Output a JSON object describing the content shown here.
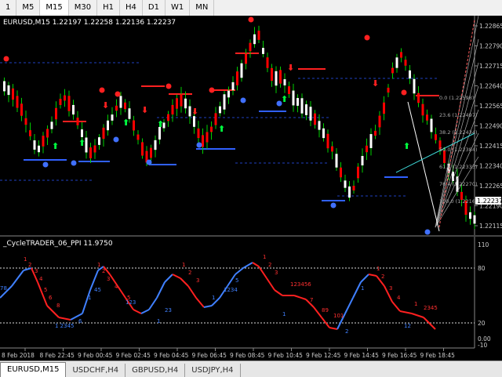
{
  "timeframes": [
    "1",
    "M5",
    "M15",
    "M30",
    "H1",
    "H4",
    "D1",
    "W1",
    "MN"
  ],
  "selected_timeframe": "M15",
  "main": {
    "title": "EURUSD,M15  1.22197 1.22258 1.22136 1.22237",
    "price_labels": [
      "1.22865",
      "1.22790",
      "1.22715",
      "1.22640",
      "1.22565",
      "1.22490",
      "1.22415",
      "1.22340",
      "1.22265",
      "1.22190",
      "1.22115"
    ],
    "current_price": "1.22237",
    "fib_labels": [
      "0.0 (1.22598)",
      "23.6 (1.22497)",
      "38.2 (1.22434)",
      "50.0 (1.22384)",
      "61.8 (1.22333)",
      "76.4 (1.22270)",
      "100.0 (1.22168)"
    ]
  },
  "indicator": {
    "title": "_CycleTRADER_06_PPI 11.9750",
    "scale_labels": [
      "110",
      "80",
      "20",
      "0.00",
      "-10"
    ]
  },
  "time_labels": [
    "8 Feb 2018",
    "8 Feb 22:45",
    "9 Feb 00:45",
    "9 Feb 02:45",
    "9 Feb 04:45",
    "9 Feb 06:45",
    "9 Feb 08:45",
    "9 Feb 10:45",
    "9 Feb 12:45",
    "9 Feb 14:45",
    "9 Feb 16:45",
    "9 Feb 18:45"
  ],
  "tabs": [
    "EURUSD,M15",
    "USDCHF,H4",
    "GBPUSD,H4",
    "USDJPY,H4"
  ],
  "colors": {
    "bull": "#ffffff",
    "bear": "#ff0000",
    "wick": "#00d000",
    "up_line": "#4080ff",
    "down_line": "#ff2020",
    "level_line": "#ffffff",
    "grid": "#2b2b2b"
  }
}
